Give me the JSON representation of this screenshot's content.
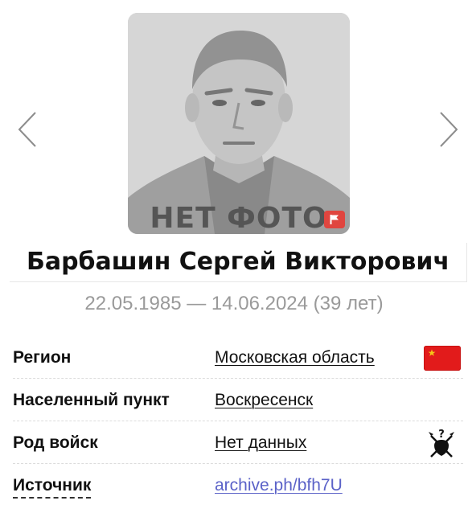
{
  "carousel": {
    "prev_icon": "chevron-left-icon",
    "next_icon": "chevron-right-icon",
    "photo_placeholder_text": "НЕТ ФОТО",
    "report_icon": "flag-icon",
    "report_color": "#e0453f"
  },
  "person": {
    "name": "Барбашин Сергей Викторович",
    "dates": "22.05.1985 — 14.06.2024 (39 лет)"
  },
  "info": {
    "rows": [
      {
        "label": "Регион",
        "value": "Московская область",
        "icon": "region-flag-icon"
      },
      {
        "label": "Населенный пункт",
        "value": "Воскресенск"
      },
      {
        "label": "Род войск",
        "value": "Нет данных",
        "icon": "crossed-weapons-question-icon"
      },
      {
        "label": "Источник",
        "value": "archive.ph/bfh7U"
      }
    ]
  },
  "colors": {
    "link": "#5b62c8",
    "muted_text": "#9a9a9a",
    "flag_red": "#e21b1b"
  }
}
